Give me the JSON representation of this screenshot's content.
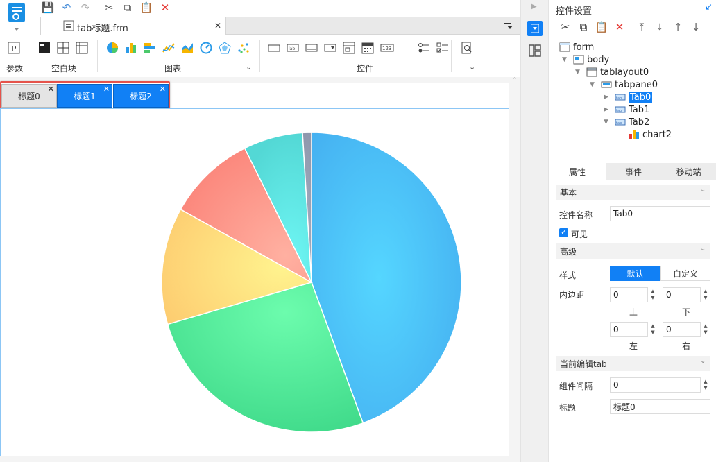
{
  "toolbar": {
    "icons": [
      "save-icon",
      "undo-icon",
      "redo-icon",
      "cut-icon",
      "copy-icon",
      "paste-icon",
      "delete-icon"
    ]
  },
  "file_tab": {
    "label": "tab标题.frm",
    "close": "✕"
  },
  "ribbon": {
    "groups": [
      {
        "label": "参数"
      },
      {
        "label": "空白块"
      },
      {
        "label": "图表"
      },
      {
        "label": "控件"
      }
    ]
  },
  "tabs": [
    {
      "label": "标题0",
      "close": "✕",
      "active": false
    },
    {
      "label": "标题1",
      "close": "✕",
      "active": true
    },
    {
      "label": "标题2",
      "close": "✕",
      "active": true
    }
  ],
  "chart_data": {
    "type": "pie",
    "values": [
      46.5,
      27.3,
      13.2,
      10.0,
      6.7,
      1.0
    ],
    "colors": [
      "#45b3f5",
      "#4de29a",
      "#fdd77a",
      "#fb8d7e",
      "#5ce4dc",
      "#9aa3b8"
    ]
  },
  "right_panel": {
    "title": "控件设置",
    "tree": [
      {
        "label": "form"
      },
      {
        "label": "body"
      },
      {
        "label": "tablayout0"
      },
      {
        "label": "tabpane0"
      },
      {
        "label": "Tab0"
      },
      {
        "label": "Tab1"
      },
      {
        "label": "Tab2"
      },
      {
        "label": "chart2"
      }
    ],
    "prop_tabs": [
      "属性",
      "事件",
      "移动端"
    ],
    "sections": {
      "basic": "基本",
      "advanced": "高级",
      "current_tab": "当前编辑tab"
    },
    "fields": {
      "name_label": "控件名称",
      "name_value": "Tab0",
      "visible_label": "可见",
      "style_label": "样式",
      "style_default": "默认",
      "style_custom": "自定义",
      "padding_label": "内边距",
      "padding_top": "0",
      "padding_bottom": "0",
      "padding_left": "0",
      "padding_right": "0",
      "top_label": "上",
      "bottom_label": "下",
      "left_label": "左",
      "right_label": "右",
      "gap_label": "组件间隔",
      "gap_value": "0",
      "title_label": "标题",
      "title_value": "标题0"
    }
  }
}
